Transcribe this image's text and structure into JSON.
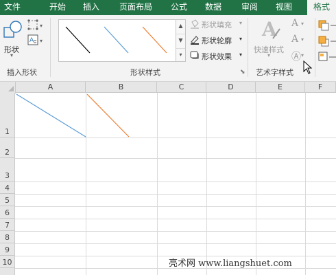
{
  "tabs": [
    {
      "label": "文件",
      "active": false
    },
    {
      "label": "开始",
      "active": false
    },
    {
      "label": "插入",
      "active": false
    },
    {
      "label": "页面布局",
      "active": false
    },
    {
      "label": "公式",
      "active": false
    },
    {
      "label": "数据",
      "active": false
    },
    {
      "label": "审阅",
      "active": false
    },
    {
      "label": "视图",
      "active": false
    },
    {
      "label": "格式",
      "active": true
    }
  ],
  "ribbon": {
    "insert_shapes": {
      "group_label": "插入形状",
      "shapes_label": "形状"
    },
    "shape_styles": {
      "group_label": "形状样式",
      "gallery_styles": [
        {
          "name": "black-line",
          "color": "#000000"
        },
        {
          "name": "blue-line",
          "color": "#5b9bd5"
        },
        {
          "name": "orange-line",
          "color": "#ed7d31"
        }
      ],
      "fill_label": "形状填充",
      "outline_label": "形状轮廓",
      "effects_label": "形状效果"
    },
    "wordart_styles": {
      "group_label": "艺术字样式",
      "quick_styles_label": "快速样式"
    }
  },
  "sheet": {
    "columns": [
      "A",
      "B",
      "C",
      "D",
      "E",
      "F"
    ],
    "rows": [
      "1",
      "2",
      "3",
      "4",
      "5",
      "6",
      "7",
      "8",
      "9",
      "10"
    ],
    "lines": [
      {
        "cell": "A1",
        "color": "#5b9bd5"
      },
      {
        "cell": "B1",
        "color": "#ed7d31"
      }
    ]
  },
  "watermark": "亮术网 www.liangshuet.com",
  "colors": {
    "accent": "#217346",
    "ribbon_bg": "#f3f3f3",
    "grid": "#dadada"
  }
}
